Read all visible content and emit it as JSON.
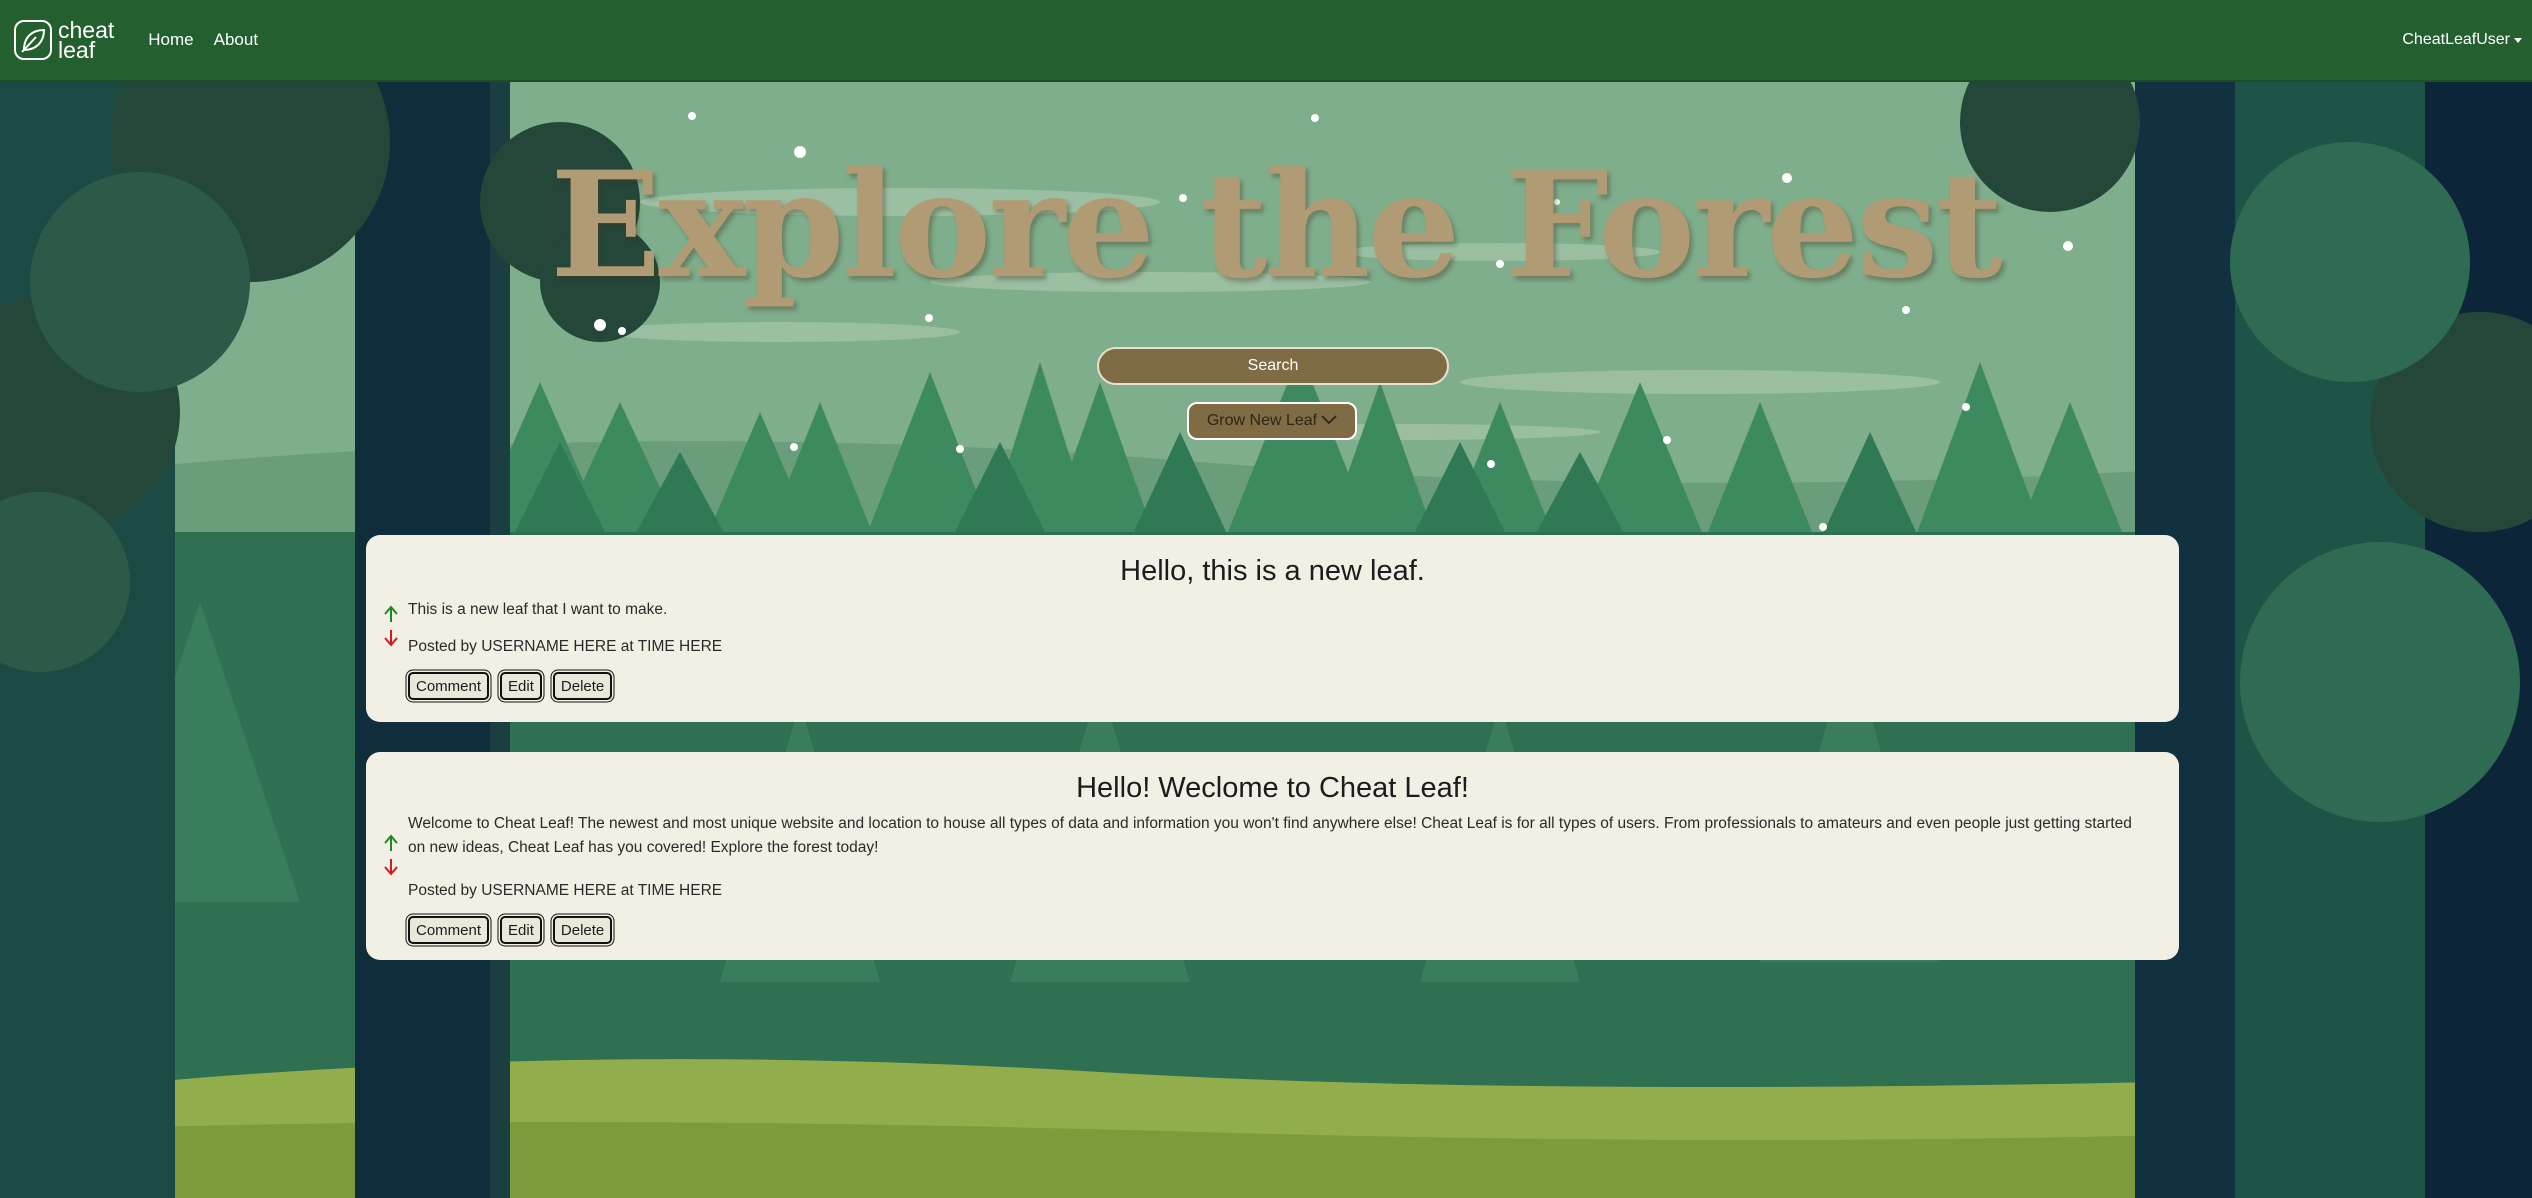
{
  "nav": {
    "brand_line1": "cheat",
    "brand_line2": "leaf",
    "home": "Home",
    "about": "About",
    "user": "CheatLeafUser"
  },
  "hero": {
    "title": "Explore the Forest",
    "search_label": "Search",
    "grow_label": "Grow New Leaf"
  },
  "posts": [
    {
      "title": "Hello, this is a new leaf.",
      "body": "This is a new leaf that I want to make.",
      "meta": "Posted by USERNAME HERE at TIME HERE",
      "comment": "Comment",
      "edit": "Edit",
      "delete": "Delete"
    },
    {
      "title": "Hello! Weclome to Cheat Leaf!",
      "body": "Welcome to Cheat Leaf! The newest and most unique website and location to house all types of data and information you won't find anywhere else! Cheat Leaf is for all types of users. From professionals to amateurs and even people just getting started on new ideas, Cheat Leaf has you covered! Explore the forest today!",
      "meta": "Posted by USERNAME HERE at TIME HERE",
      "comment": "Comment",
      "edit": "Edit",
      "delete": "Delete"
    }
  ],
  "icons": {
    "upvote": "arrow-up-icon",
    "downvote": "arrow-down-icon",
    "logo": "leaf-icon",
    "dropdown": "chevron-down-icon"
  },
  "colors": {
    "navbar": "#245f30",
    "card": "#f2efe5",
    "accent_brown": "#7f6b44",
    "title_tan": "#b09b74",
    "upvote": "#1a8a1a",
    "downvote": "#d11a1a"
  }
}
